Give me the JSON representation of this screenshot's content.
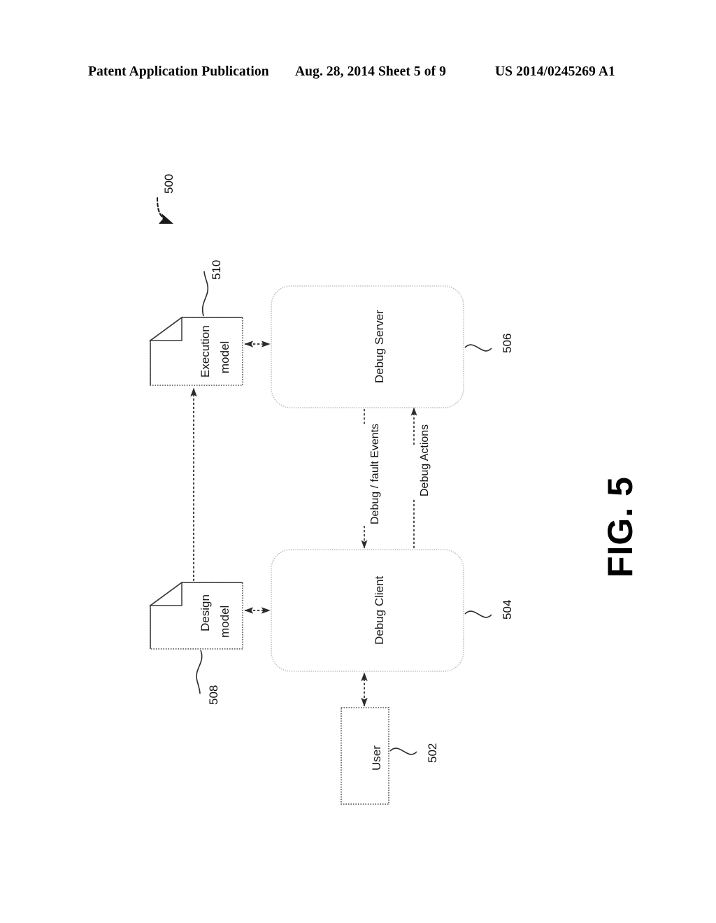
{
  "header": {
    "left": "Patent Application Publication",
    "middle": "Aug. 28, 2014  Sheet 5 of 9",
    "right": "US 2014/0245269 A1"
  },
  "figure": {
    "caption": "FIG. 5",
    "system_ref": "500",
    "nodes": [
      {
        "id": "execution-model",
        "label_line1": "Execution",
        "label_line2": "model",
        "ref": "510",
        "shape": "document"
      },
      {
        "id": "debug-server",
        "label": "Debug Server",
        "ref": "506",
        "shape": "rounded-rect"
      },
      {
        "id": "design-model",
        "label_line1": "Design",
        "label_line2": "model",
        "ref": "508",
        "shape": "document"
      },
      {
        "id": "debug-client",
        "label": "Debug Client",
        "ref": "504",
        "shape": "rounded-rect"
      },
      {
        "id": "user",
        "label": "User",
        "ref": "502",
        "shape": "rect"
      }
    ],
    "connectors": [
      {
        "id": "events",
        "label": "Debug / fault Events",
        "from": "debug-server",
        "to": "debug-client",
        "arrow": "single"
      },
      {
        "id": "actions",
        "label": "Debug Actions",
        "from": "debug-client",
        "to": "debug-server",
        "arrow": "single"
      },
      {
        "id": "exec-server",
        "label": "",
        "from": "execution-model",
        "to": "debug-server",
        "arrow": "double"
      },
      {
        "id": "design-client",
        "label": "",
        "from": "design-model",
        "to": "debug-client",
        "arrow": "double"
      },
      {
        "id": "design-exec",
        "label": "",
        "from": "design-model",
        "to": "execution-model",
        "arrow": "single"
      },
      {
        "id": "client-user",
        "label": "",
        "from": "debug-client",
        "to": "user",
        "arrow": "double"
      }
    ]
  },
  "colors": {
    "ink": "#000000",
    "line_solid": "#333333",
    "line_light": "#b8b8b8",
    "line_dotted": "#555555"
  }
}
